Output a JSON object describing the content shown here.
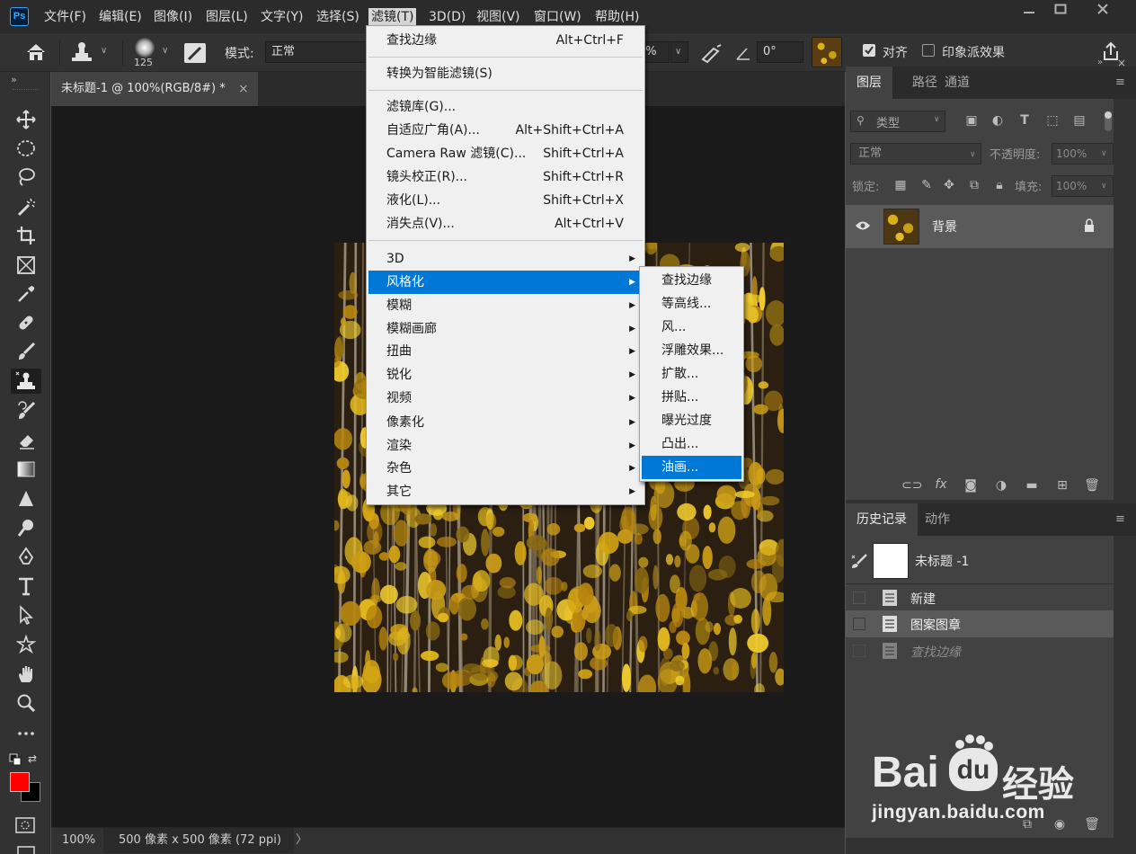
{
  "app": {
    "logo": "Ps"
  },
  "menubar": {
    "items": [
      "文件(F)",
      "编辑(E)",
      "图像(I)",
      "图层(L)",
      "文字(Y)",
      "选择(S)",
      "滤镜(T)",
      "3D(D)",
      "视图(V)",
      "窗口(W)",
      "帮助(H)"
    ],
    "active_item": "滤镜(T)",
    "window_buttons": [
      "minimize-icon",
      "maximize-icon",
      "close-icon"
    ]
  },
  "options": {
    "brush_size": "125",
    "mode_label": "模式:",
    "mode_value": "正常",
    "flow_value": "0%",
    "angle_value": "0°",
    "align_label": "对齐",
    "impressionist_label": "印象派效果"
  },
  "document": {
    "tab_title": "未标题-1 @ 100%(RGB/8#) *",
    "tab_close": "×"
  },
  "status": {
    "zoom": "100%",
    "info": "500 像素 x 500 像素 (72 ppi)",
    "arrow": "〉"
  },
  "colors": {
    "foreground": "#ff0000",
    "background": "#000000",
    "menu_highlight": "#0078d7"
  },
  "filter_menu": {
    "items": [
      {
        "label": "查找边缘",
        "shortcut": "Alt+Ctrl+F"
      },
      {
        "label": "转换为智能滤镜(S)",
        "shortcut": ""
      },
      {
        "label": "滤镜库(G)...",
        "shortcut": ""
      },
      {
        "label": "自适应广角(A)...",
        "shortcut": "Alt+Shift+Ctrl+A"
      },
      {
        "label": "Camera Raw 滤镜(C)...",
        "shortcut": "Shift+Ctrl+A"
      },
      {
        "label": "镜头校正(R)...",
        "shortcut": "Shift+Ctrl+R"
      },
      {
        "label": "液化(L)...",
        "shortcut": "Shift+Ctrl+X"
      },
      {
        "label": "消失点(V)...",
        "shortcut": "Alt+Ctrl+V"
      },
      {
        "label": "3D",
        "shortcut": ""
      },
      {
        "label": "风格化",
        "shortcut": ""
      },
      {
        "label": "模糊",
        "shortcut": ""
      },
      {
        "label": "模糊画廊",
        "shortcut": ""
      },
      {
        "label": "扭曲",
        "shortcut": ""
      },
      {
        "label": "锐化",
        "shortcut": ""
      },
      {
        "label": "视频",
        "shortcut": ""
      },
      {
        "label": "像素化",
        "shortcut": ""
      },
      {
        "label": "渲染",
        "shortcut": ""
      },
      {
        "label": "杂色",
        "shortcut": ""
      },
      {
        "label": "其它",
        "shortcut": ""
      }
    ],
    "highlighted": "风格化"
  },
  "stylize_submenu": {
    "items": [
      "查找边缘",
      "等高线...",
      "风...",
      "浮雕效果...",
      "扩散...",
      "拼贴...",
      "曝光过度",
      "凸出...",
      "油画..."
    ],
    "highlighted": "油画..."
  },
  "layers_panel": {
    "tabs": [
      "图层",
      "路径",
      "通道"
    ],
    "filter_label": "类型",
    "blend_mode": "正常",
    "opacity_label": "不透明度:",
    "opacity_value": "100%",
    "lock_label": "锁定:",
    "fill_label": "填充:",
    "fill_value": "100%",
    "layers": [
      {
        "name": "背景",
        "visible": true,
        "locked": true
      }
    ]
  },
  "history_panel": {
    "tabs": [
      "历史记录",
      "动作"
    ],
    "snapshot_name": "未标题 -1",
    "states": [
      {
        "label": "新建",
        "state": "normal"
      },
      {
        "label": "图案图章",
        "state": "current"
      },
      {
        "label": "查找边缘",
        "state": "undone"
      }
    ]
  },
  "watermark": {
    "logo_text": "Bai",
    "logo_du": "du",
    "brand": "经验",
    "url": "jingyan.baidu.com"
  }
}
